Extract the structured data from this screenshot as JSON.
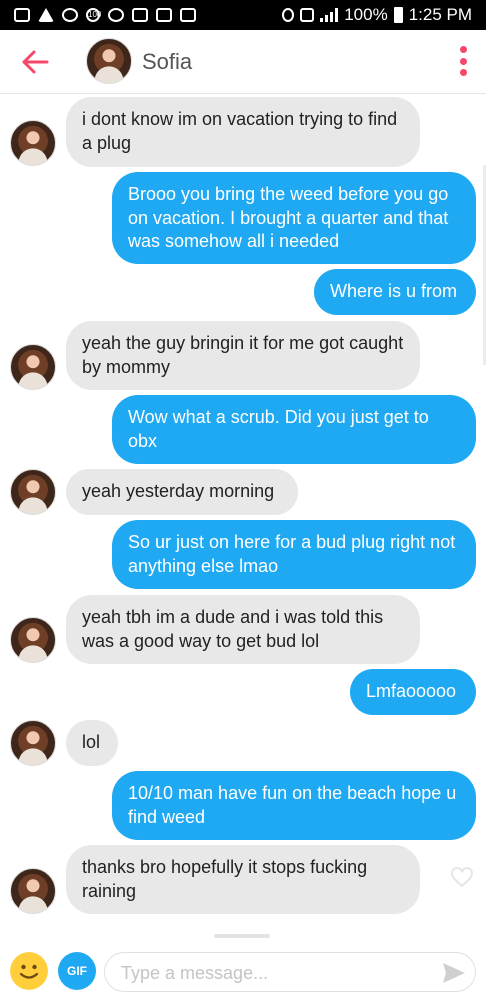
{
  "status_bar": {
    "battery": "100%",
    "time": "1:25 PM",
    "icon_text": "100"
  },
  "header": {
    "name": "Sofia"
  },
  "messages": [
    {
      "from": "them",
      "text": "i dont know im on vacation trying to find a plug"
    },
    {
      "from": "me",
      "text": "Brooo you bring the weed before you go on vacation. I brought a quarter and that was somehow all i needed"
    },
    {
      "from": "me",
      "text": "Where is u from"
    },
    {
      "from": "them",
      "text": "yeah the guy bringin it for me got caught by mommy"
    },
    {
      "from": "me",
      "text": "Wow what a scrub. Did you just get to obx"
    },
    {
      "from": "them",
      "text": "yeah yesterday morning"
    },
    {
      "from": "me",
      "text": "So ur just on here for a bud plug right not anything else lmao"
    },
    {
      "from": "them",
      "text": "yeah tbh im a dude and i was told this was a good way to get bud lol"
    },
    {
      "from": "me",
      "text": "Lmfaooooo"
    },
    {
      "from": "them",
      "text": "lol"
    },
    {
      "from": "me",
      "text": "10/10 man have fun on the beach hope u find weed"
    },
    {
      "from": "them",
      "text": "thanks bro hopefully it stops fucking raining"
    }
  ],
  "composer": {
    "gif_label": "GIF",
    "placeholder": "Type a message..."
  },
  "colors": {
    "accent": "#f5476a",
    "outgoing": "#1fa9f3",
    "incoming": "#e8e8e8"
  }
}
